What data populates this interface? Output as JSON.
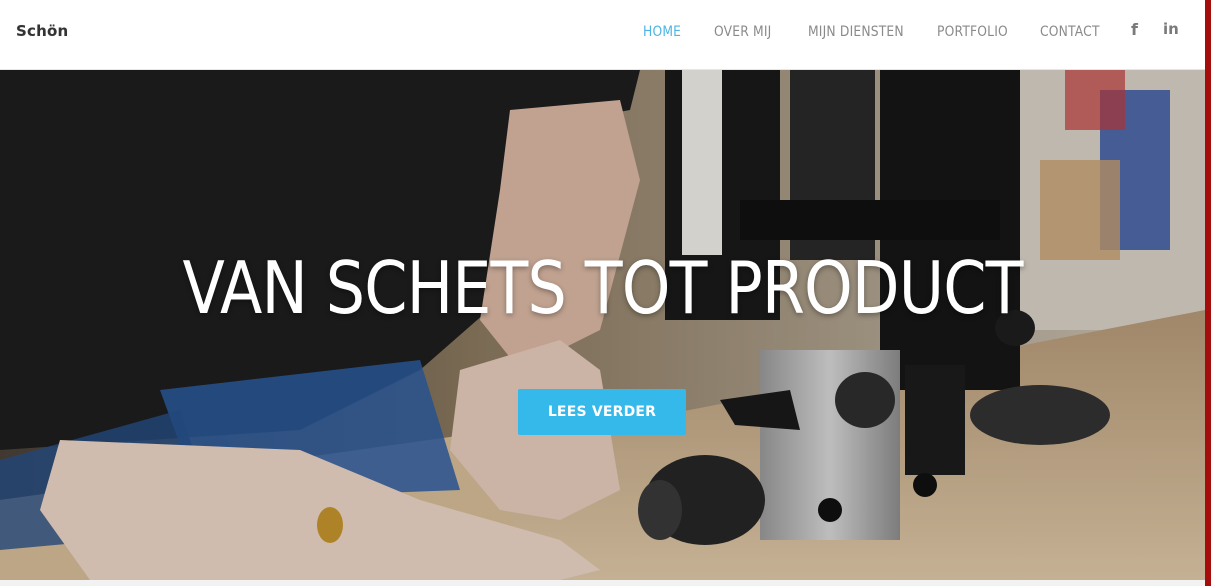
{
  "brand": {
    "name": "Schön"
  },
  "nav": {
    "items": [
      {
        "label": "HOME",
        "active": true
      },
      {
        "label": "OVER MIJ",
        "active": false
      },
      {
        "label": "MIJN DIENSTEN",
        "active": false
      },
      {
        "label": "PORTFOLIO",
        "active": false
      },
      {
        "label": "CONTACT",
        "active": false
      }
    ],
    "social": [
      {
        "icon": "facebook-icon",
        "glyph": "f"
      },
      {
        "icon": "linkedin-icon",
        "glyph": "in"
      }
    ]
  },
  "hero": {
    "title": "VAN SCHETS TOT PRODUCT",
    "cta_label": "LEES VERDER",
    "image": "workshop-bandsaw-photo"
  },
  "colors": {
    "accent": "#35b8ea",
    "nav_active": "#4db5e5",
    "nav_text": "#8a8a8a"
  }
}
